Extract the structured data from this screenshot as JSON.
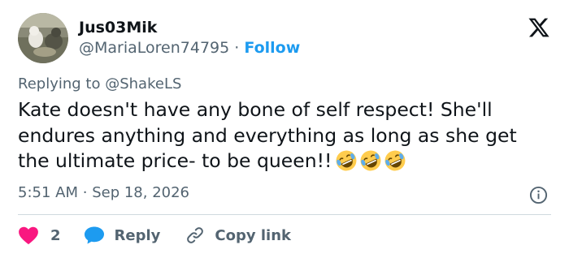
{
  "author": {
    "name": "Jus03Mik",
    "handle": "@MariaLoren74795",
    "separator": "·",
    "follow_label": "Follow"
  },
  "reply_context": {
    "prefix": "Replying to",
    "mention": "@ShakeLS"
  },
  "tweet": {
    "text": "Kate doesn't have any bone of self respect! She'll endures anything and everything as long as she get the ultimate price- to be queen!!",
    "emojis": [
      "rolling-on-floor-laughing",
      "rolling-on-floor-laughing",
      "rolling-on-floor-laughing"
    ],
    "time": "5:51 AM",
    "separator": "·",
    "date": "Sep 18, 2026"
  },
  "actions": {
    "like_count": "2",
    "reply_label": "Reply",
    "copy_label": "Copy link"
  },
  "colors": {
    "accent": "#1d9bf0",
    "like": "#f91880",
    "muted": "#536471",
    "text": "#0f1419"
  },
  "icons": {
    "platform": "x-logo-icon",
    "info": "info-icon",
    "like": "heart-icon",
    "reply": "chat-bubble-icon",
    "copy": "link-icon"
  }
}
